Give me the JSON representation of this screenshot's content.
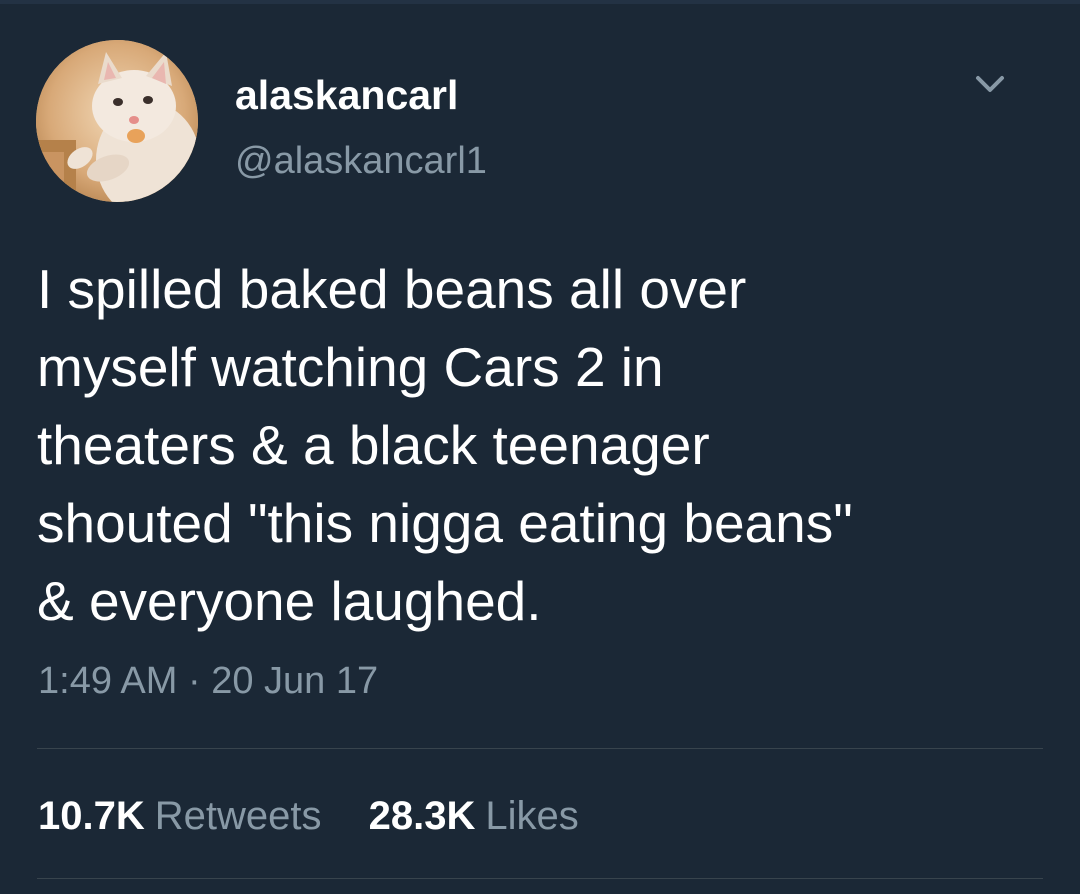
{
  "user": {
    "display_name": "alaskancarl",
    "handle": "@alaskancarl1"
  },
  "tweet": {
    "text": "I spilled baked beans all over\nmyself watching Cars 2 in\ntheaters & a black teenager\nshouted \"this nigga eating beans\"\n& everyone laughed.",
    "timestamp": "1:49 AM · 20 Jun 17"
  },
  "stats": {
    "retweets_count": "10.7K",
    "retweets_label": "Retweets",
    "likes_count": "28.3K",
    "likes_label": "Likes"
  },
  "colors": {
    "background": "#1b2836",
    "secondary_text": "#8899a6",
    "divider": "#38444d"
  },
  "icons": {
    "menu": "chevron-down-icon"
  }
}
